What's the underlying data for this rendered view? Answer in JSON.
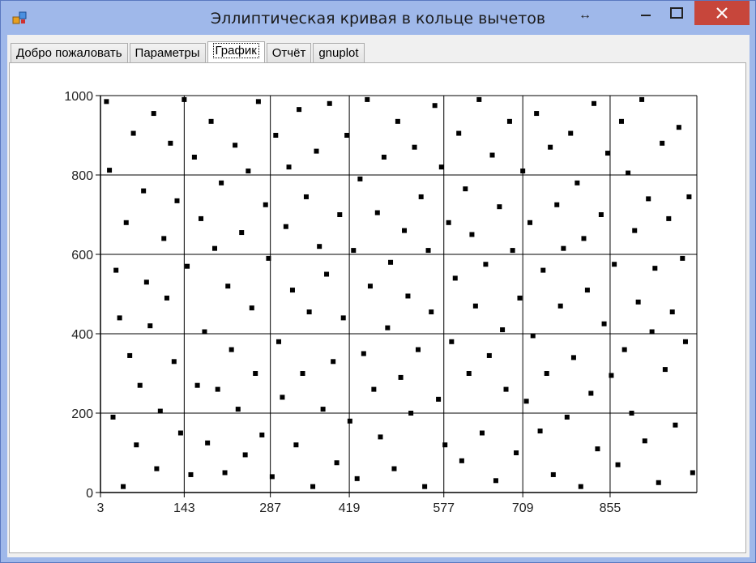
{
  "window": {
    "title": "Эллиптическая кривая в кольце вычетов"
  },
  "titlebar_controls": {
    "resize_glyph": "↔",
    "minimize_glyph": "—",
    "maximize_glyph": "☐",
    "close_glyph": "✕"
  },
  "tabs": [
    {
      "label": "Добро пожаловать",
      "active": false
    },
    {
      "label": "Параметры",
      "active": false
    },
    {
      "label": "График",
      "active": true
    },
    {
      "label": "Отчёт",
      "active": false
    },
    {
      "label": "gnuplot",
      "active": false
    }
  ],
  "colors": {
    "close_button": "#c7463b",
    "marker": "#000000",
    "window_frame": "#9fb8ea"
  },
  "chart_data": {
    "type": "scatter",
    "title": "",
    "xlabel": "",
    "ylabel": "",
    "xlim": [
      3,
      1000
    ],
    "ylim": [
      0,
      1000
    ],
    "x_ticks": [
      3,
      143,
      287,
      419,
      577,
      709,
      855
    ],
    "y_ticks": [
      0,
      200,
      400,
      600,
      800,
      1000
    ],
    "grid": true,
    "legend": "none",
    "marker": "square",
    "x": [
      13,
      18,
      24,
      29,
      35,
      41,
      46,
      52,
      58,
      63,
      69,
      75,
      80,
      86,
      92,
      97,
      103,
      109,
      114,
      120,
      126,
      131,
      137,
      143,
      148,
      154,
      160,
      165,
      171,
      177,
      182,
      188,
      194,
      199,
      205,
      211,
      216,
      222,
      228,
      233,
      239,
      245,
      250,
      256,
      262,
      267,
      273,
      279,
      284,
      290,
      296,
      301,
      307,
      313,
      318,
      324,
      330,
      335,
      341,
      347,
      352,
      358,
      364,
      369,
      375,
      381,
      386,
      392,
      398,
      403,
      409,
      415,
      420,
      426,
      432,
      437,
      443,
      449,
      454,
      460,
      466,
      471,
      477,
      483,
      488,
      494,
      500,
      505,
      511,
      517,
      522,
      528,
      534,
      539,
      545,
      551,
      556,
      562,
      568,
      573,
      579,
      585,
      590,
      596,
      602,
      607,
      613,
      619,
      624,
      630,
      636,
      641,
      647,
      653,
      658,
      664,
      670,
      675,
      681,
      687,
      692,
      698,
      704,
      709,
      715,
      721,
      726,
      732,
      738,
      743,
      749,
      755,
      760,
      766,
      772,
      777,
      783,
      789,
      794,
      800,
      806,
      811,
      817,
      823,
      828,
      834,
      840,
      845,
      851,
      857,
      862,
      868,
      874,
      879,
      885,
      891,
      896,
      902,
      908,
      913,
      919,
      925,
      930,
      936,
      942,
      947,
      953,
      959,
      964,
      970,
      976,
      981,
      987,
      993
    ],
    "y": [
      985,
      812,
      190,
      560,
      440,
      15,
      680,
      345,
      905,
      120,
      270,
      760,
      530,
      420,
      955,
      60,
      205,
      640,
      490,
      880,
      330,
      735,
      150,
      990,
      570,
      45,
      845,
      270,
      690,
      405,
      125,
      935,
      615,
      260,
      780,
      50,
      520,
      360,
      875,
      210,
      655,
      95,
      810,
      465,
      300,
      985,
      145,
      725,
      590,
      40,
      900,
      380,
      240,
      670,
      820,
      510,
      120,
      965,
      300,
      745,
      455,
      15,
      860,
      620,
      210,
      550,
      980,
      330,
      75,
      700,
      440,
      900,
      180,
      610,
      35,
      790,
      350,
      990,
      520,
      260,
      705,
      140,
      845,
      415,
      580,
      60,
      935,
      290,
      660,
      495,
      200,
      870,
      360,
      745,
      15,
      610,
      455,
      975,
      235,
      820,
      120,
      680,
      380,
      540,
      905,
      80,
      765,
      300,
      650,
      470,
      990,
      150,
      575,
      345,
      850,
      30,
      720,
      410,
      260,
      935,
      610,
      100,
      490,
      810,
      230,
      680,
      395,
      955,
      155,
      560,
      300,
      870,
      45,
      725,
      470,
      615,
      190,
      905,
      340,
      780,
      15,
      640,
      510,
      250,
      980,
      110,
      700,
      425,
      855,
      295,
      575,
      70,
      935,
      360,
      805,
      200,
      660,
      480,
      990,
      130,
      740,
      405,
      565,
      25,
      880,
      310,
      690,
      455,
      170,
      920,
      590,
      380,
      745,
      50
    ]
  }
}
